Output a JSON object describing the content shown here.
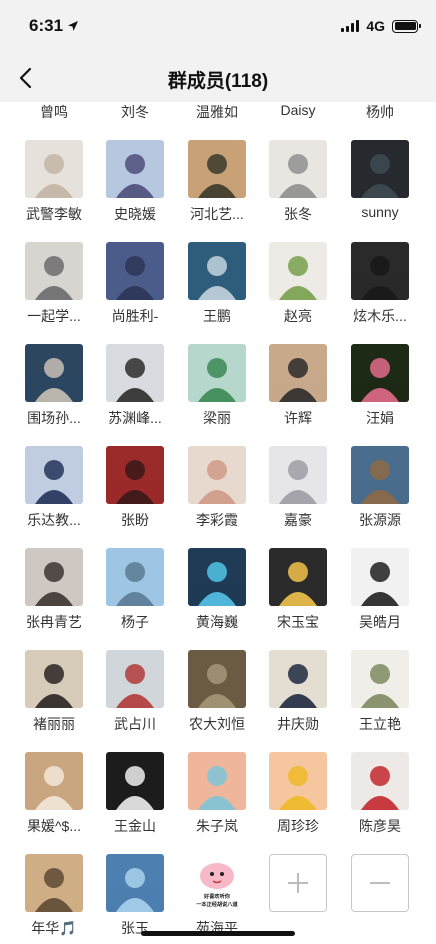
{
  "status": {
    "time": "6:31",
    "network": "4G"
  },
  "nav": {
    "title": "群成员(118)"
  },
  "members": [
    {
      "name": "曾鸣"
    },
    {
      "name": "刘冬"
    },
    {
      "name": "温雅如"
    },
    {
      "name": "Daisy"
    },
    {
      "name": "杨帅"
    },
    {
      "name": "武警李敏"
    },
    {
      "name": "史晓媛"
    },
    {
      "name": "河北艺..."
    },
    {
      "name": "张冬"
    },
    {
      "name": "sunny"
    },
    {
      "name": "一起学..."
    },
    {
      "name": "尚胜利-"
    },
    {
      "name": "王鹏"
    },
    {
      "name": "赵亮"
    },
    {
      "name": "炫木乐..."
    },
    {
      "name": "围场孙..."
    },
    {
      "name": "苏渊峰..."
    },
    {
      "name": "梁丽"
    },
    {
      "name": "许辉"
    },
    {
      "name": "汪娟"
    },
    {
      "name": "乐达教..."
    },
    {
      "name": "张盼"
    },
    {
      "name": "李彩霞"
    },
    {
      "name": "嘉豪"
    },
    {
      "name": "张源源"
    },
    {
      "name": "张冉青艺"
    },
    {
      "name": "杨子"
    },
    {
      "name": "黄海巍"
    },
    {
      "name": "宋玉宝"
    },
    {
      "name": "吴皓月"
    },
    {
      "name": "褚丽丽"
    },
    {
      "name": "武占川"
    },
    {
      "name": "农大刘恒"
    },
    {
      "name": "井庆勋"
    },
    {
      "name": "王立艳"
    },
    {
      "name": "果媛^$..."
    },
    {
      "name": "王金山"
    },
    {
      "name": "朱子岚"
    },
    {
      "name": "周珍珍"
    },
    {
      "name": "陈彦昊"
    },
    {
      "name": "年华🎵"
    },
    {
      "name": "张玉"
    },
    {
      "name": "苑海平",
      "avatar_text": [
        "好喜欢听你",
        "一本正经胡说八道"
      ]
    }
  ],
  "actions": {
    "add": "add-member-icon",
    "remove": "remove-member-icon"
  },
  "colors": {
    "bar_bg": "#f2f2f2",
    "text": "#333333",
    "border": "#c8c8c8"
  }
}
